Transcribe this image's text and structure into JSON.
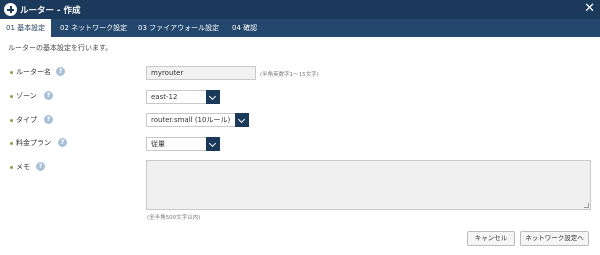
{
  "window": {
    "title": "ルーター - 作成",
    "close_label": "✕"
  },
  "tabs": [
    {
      "label": "01 基本設定"
    },
    {
      "label": "02 ネットワーク設定"
    },
    {
      "label": "03 ファイアウォール設定"
    },
    {
      "label": "04 確認"
    }
  ],
  "intro": "ルーターの基本設定を行います。",
  "form": {
    "name": {
      "label": "ルーター名",
      "value": "myrouter",
      "hint": "(半角英数字1～15文字)"
    },
    "zone": {
      "label": "ゾーン",
      "value": "east-12"
    },
    "type": {
      "label": "タイプ",
      "value": "router.small (10ルール)"
    },
    "plan": {
      "label": "料金プラン",
      "value": "従量"
    },
    "memo": {
      "label": "メモ",
      "value": "",
      "hint": "(全半角500文字以内)"
    }
  },
  "help_glyph": "?",
  "buttons": {
    "cancel": "キャンセル",
    "next": "ネットワーク設定へ"
  },
  "colors": {
    "titlebar": "#1b3a5b",
    "tabbar": "#24486d",
    "required_dot": "#8aa34f",
    "help_icon": "#a9c0d8"
  }
}
